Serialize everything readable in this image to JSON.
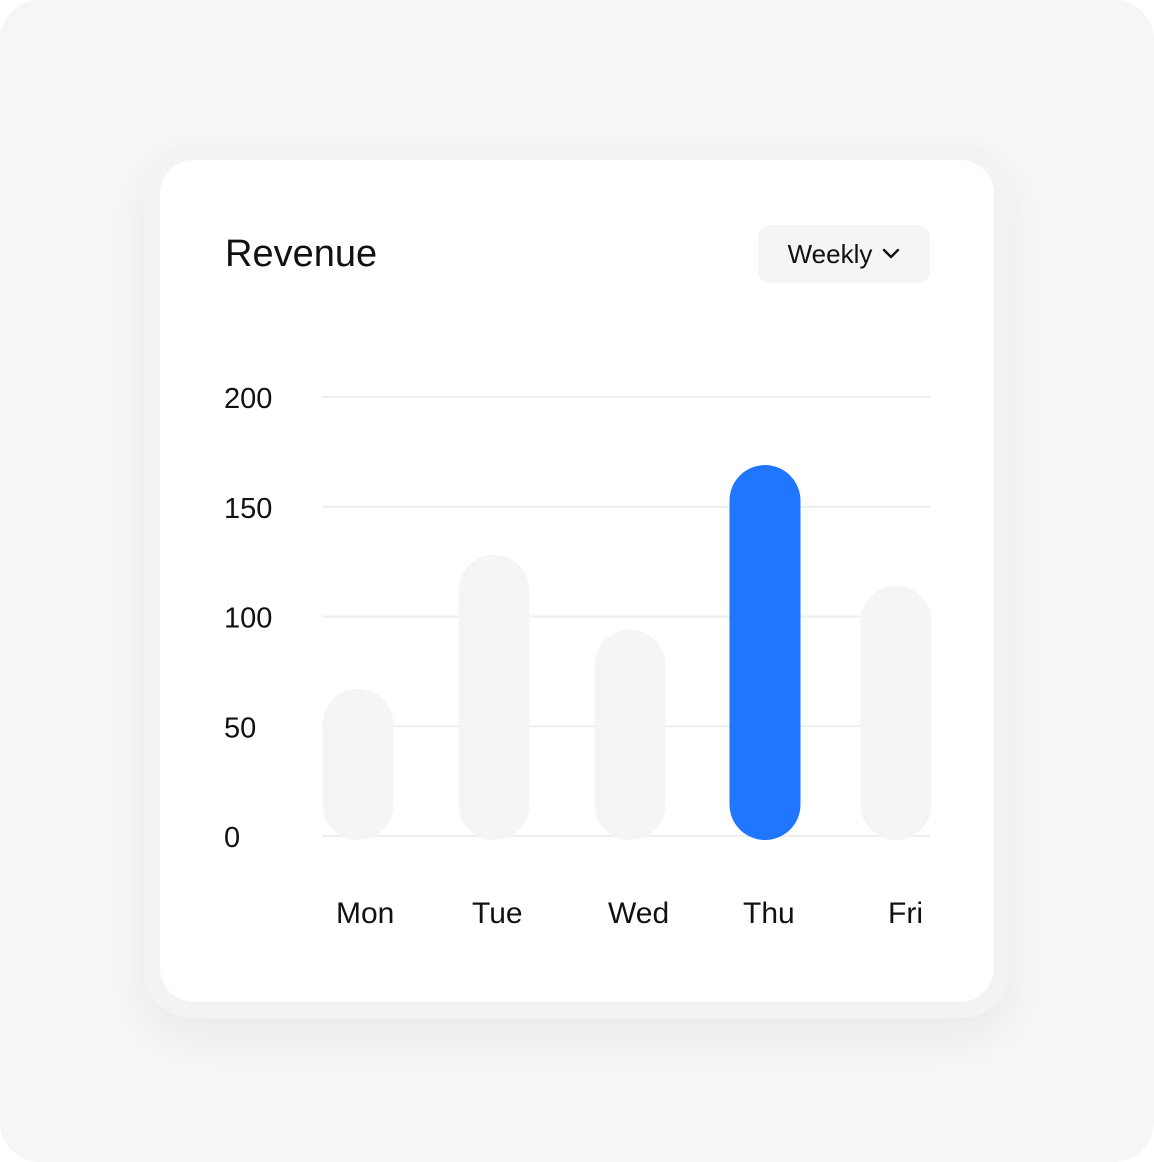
{
  "card": {
    "title": "Revenue",
    "period_select": {
      "selected": "Weekly",
      "icon": "chevron-down-icon"
    }
  },
  "colors": {
    "highlight_bar": "#2176ff",
    "default_bar": "#f5f5f5",
    "gridline": "#eeeeee",
    "text": "#111111"
  },
  "chart_data": {
    "type": "bar",
    "title": "Revenue",
    "xlabel": "",
    "ylabel": "",
    "categories": [
      "Mon",
      "Tue",
      "Wed",
      "Thu",
      "Fri"
    ],
    "values": [
      67,
      128,
      94,
      169,
      114
    ],
    "highlighted_category": "Thu",
    "ylim": [
      0,
      200
    ],
    "yticks": [
      0,
      50,
      100,
      150,
      200
    ],
    "grid": true,
    "legend": "none"
  }
}
